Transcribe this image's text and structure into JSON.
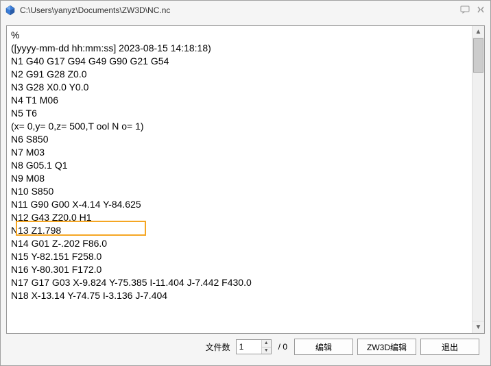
{
  "window": {
    "title": "C:\\Users\\yanyz\\Documents\\ZW3D\\NC.nc"
  },
  "code": {
    "lines": [
      "%",
      "([yyyy-mm-dd hh:mm:ss] 2023-08-15 14:18:18)",
      "N1 G40 G17 G94 G49 G90 G21 G54",
      "N2 G91 G28 Z0.0",
      "N3 G28 X0.0 Y0.0",
      "N4 T1 M06",
      "N5 T6",
      "(x= 0,y= 0,z= 500,T ool N o= 1)",
      "N6 S850",
      "N7 M03",
      "N8 G05.1 Q1",
      "N9 M08",
      "N10 S850",
      "N11 G90 G00 X-4.14 Y-84.625",
      "N12 G43 Z20.0 H1",
      "N13 Z1.798",
      "N14 G01 Z-.202 F86.0",
      "N15 Y-82.151 F258.0",
      "N16 Y-80.301 F172.0",
      "N17 G17 G03 X-9.824 Y-75.385 I-11.404 J-7.442 F430.0",
      "N18 X-13.14 Y-74.75 I-3.136 J-7.404"
    ],
    "highlighted_index": 14
  },
  "footer": {
    "file_count_label": "文件数",
    "file_count_value": "1",
    "total_suffix": "/ 0",
    "buttons": {
      "edit": "编辑",
      "zw3d_edit": "ZW3D编辑",
      "exit": "退出"
    }
  }
}
